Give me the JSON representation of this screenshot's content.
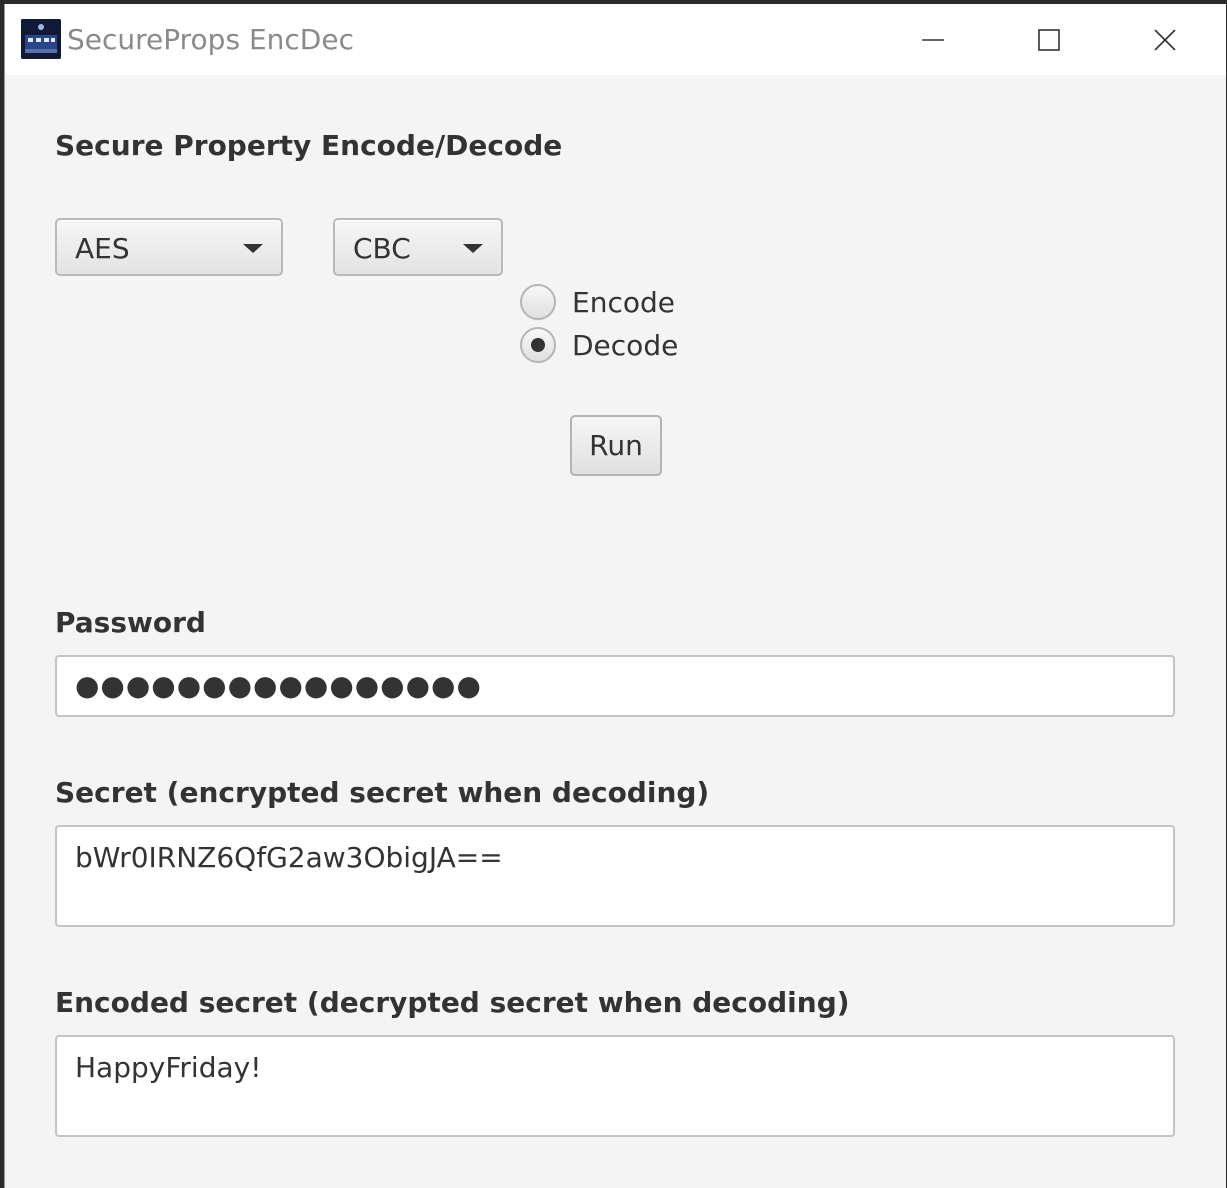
{
  "window": {
    "title": "SecureProps EncDec",
    "icon": "app-logo-icon",
    "controls": [
      "minimize-icon",
      "maximize-icon",
      "close-icon"
    ]
  },
  "main": {
    "heading": "Secure Property Encode/Decode",
    "algorithm": {
      "selected": "AES"
    },
    "mode": {
      "selected": "CBC"
    },
    "operation": {
      "options": [
        {
          "label": "Encode",
          "checked": false
        },
        {
          "label": "Decode",
          "checked": true
        }
      ]
    },
    "run_label": "Run",
    "password": {
      "label": "Password",
      "masked_value": "●●●●●●●●●●●●●●●●"
    },
    "secret": {
      "label": "Secret (encrypted secret when decoding)",
      "value": "bWr0IRNZ6QfG2aw3ObigJA=="
    },
    "encoded": {
      "label": "Encoded secret (decrypted secret when decoding)",
      "value": "HappyFriday!"
    }
  }
}
